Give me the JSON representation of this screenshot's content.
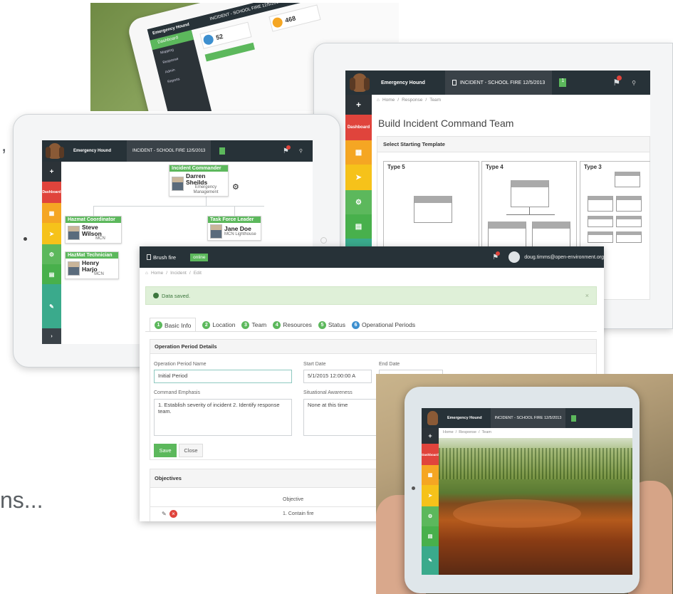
{
  "background_fragments": {
    "text_left": "ns..."
  },
  "tablet_top": {
    "topbar": {
      "brand": "Emergency Hound",
      "incident": "INCIDENT - SCHOOL FIRE 12/5/2013"
    },
    "nav": {
      "dashboard": "Dashboard",
      "mapping": "Mapping",
      "response": "Response",
      "admin": "Admin",
      "reports": "Reports"
    },
    "stats": {
      "count1": "52",
      "count2": "468"
    }
  },
  "tablet_build": {
    "topbar": {
      "brand": "Emergency Hound",
      "incident": "INCIDENT - SCHOOL FIRE 12/5/2013",
      "badge": "1"
    },
    "breadcrumb": {
      "home": "Home",
      "response": "Response",
      "team": "Team"
    },
    "sidebar": {
      "dashboard": "Dashboard"
    },
    "heading": "Build Incident Command Team",
    "section": "Select Starting Template",
    "templates": [
      "Type 5",
      "Type 4",
      "Type 3"
    ]
  },
  "tablet_org": {
    "topbar": {
      "brand": "Emergency Hound",
      "incident": "INCIDENT - SCHOOL FIRE 12/5/2013"
    },
    "sidebar": {
      "dashboard": "Dashboard"
    },
    "commander": {
      "role": "Incident Commander",
      "name": "Darren Sheilds",
      "org": "Emergency Management"
    },
    "hazmat_coord": {
      "role": "Hazmat Coordinator",
      "name": "Steve Wilson",
      "org": "MCN"
    },
    "task_force": {
      "role": "Task Force Leader",
      "name": "Jane Doe",
      "org": "MCN Lighthouse"
    },
    "hazmat_tech": {
      "role": "HazMat Technician",
      "name": "Henry Harjo",
      "org": "MCN"
    }
  },
  "form_window": {
    "topbar": {
      "incident": "Brush fire",
      "status": "online",
      "user": "doug.timms@open-environment.org"
    },
    "breadcrumb": {
      "home": "Home",
      "incident": "Incident",
      "edit": "Edit"
    },
    "alert": "Data saved.",
    "tabs": [
      {
        "n": "1",
        "label": "Basic Info"
      },
      {
        "n": "2",
        "label": "Location"
      },
      {
        "n": "3",
        "label": "Team"
      },
      {
        "n": "4",
        "label": "Resources"
      },
      {
        "n": "5",
        "label": "Status"
      },
      {
        "n": "6",
        "label": "Operational Periods"
      }
    ],
    "panel_title": "Operation Period Details",
    "fields": {
      "op_name_label": "Operation Period Name",
      "op_name_value": "Initial Period",
      "start_label": "Start Date",
      "start_value": "5/1/2015 12:00:00 A",
      "end_label": "End Date",
      "emphasis_label": "Command Emphasis",
      "emphasis_value": "1. Establish severity of incident 2. Identify response team.",
      "awareness_label": "Situational Awareness",
      "awareness_value": "None at this time"
    },
    "buttons": {
      "save": "Save",
      "close": "Close"
    },
    "objectives": {
      "title": "Objectives",
      "col_header": "Objective",
      "row1": "1. Contain fire"
    }
  },
  "tablet_photo": {
    "topbar": {
      "brand": "Emergency Hound",
      "incident": "INCIDENT - SCHOOL FIRE 12/5/2013"
    },
    "breadcrumb": {
      "home": "Home",
      "response": "Response",
      "team": "Team"
    },
    "sidebar": {
      "dashboard": "Dashboard"
    }
  },
  "colors": {
    "topbar": "#273238",
    "accent_green": "#5cb85c",
    "alert_red": "#e0443c",
    "orange": "#f5a623",
    "yellow": "#f6c21a"
  }
}
